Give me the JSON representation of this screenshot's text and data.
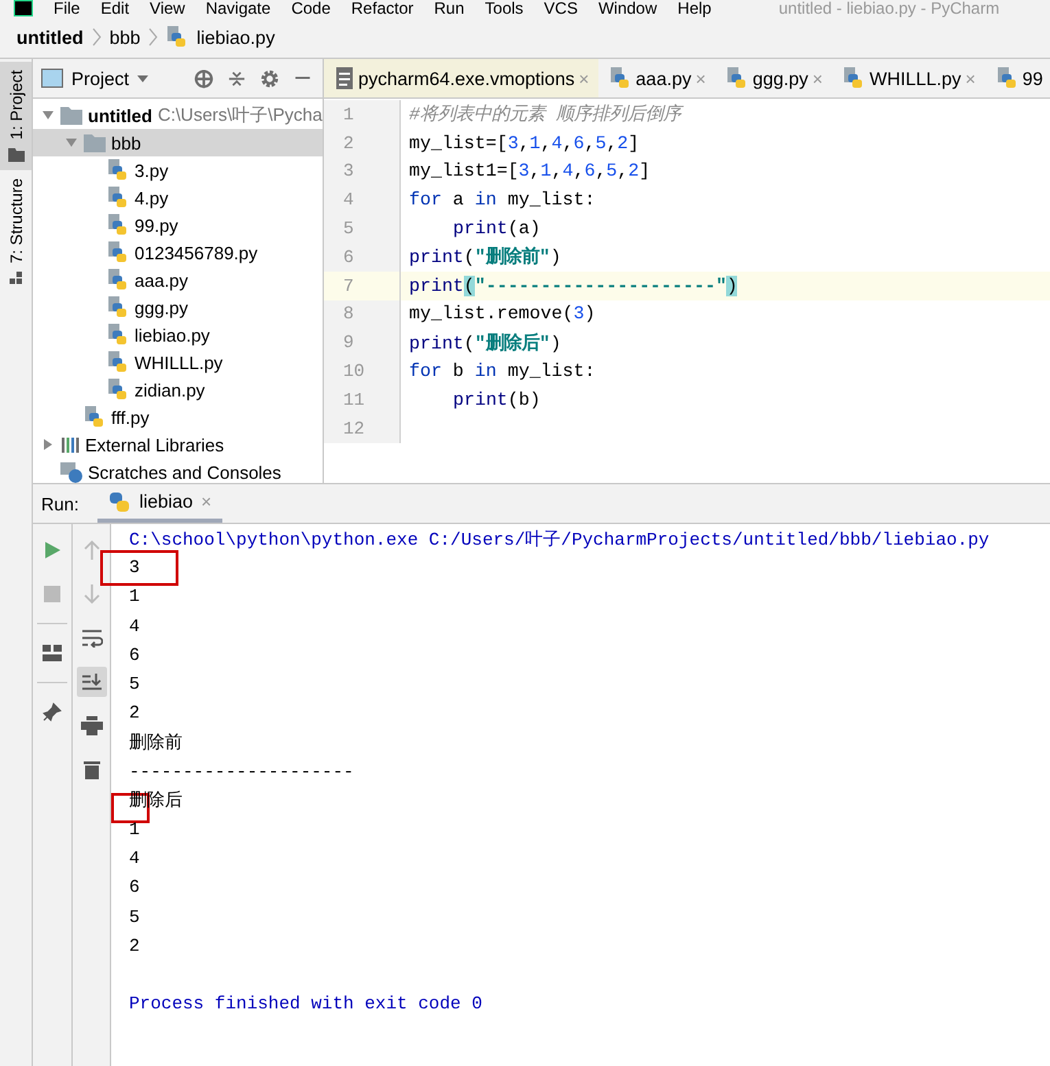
{
  "window": {
    "title": "untitled - liebiao.py - PyCharm"
  },
  "menu": [
    "File",
    "Edit",
    "View",
    "Navigate",
    "Code",
    "Refactor",
    "Run",
    "Tools",
    "VCS",
    "Window",
    "Help"
  ],
  "breadcrumbs": [
    "untitled",
    "bbb",
    "liebiao.py"
  ],
  "tool_strip": [
    {
      "label": "1: Project",
      "kind": "project",
      "selected": true
    },
    {
      "label": "7: Structure",
      "kind": "structure",
      "selected": false
    }
  ],
  "project_panel": {
    "title": "Project",
    "tree": [
      {
        "name": "untitled",
        "path": "C:\\Users\\叶子\\Pycha",
        "kind": "folder",
        "expanded": true,
        "selected": false,
        "children": [
          {
            "name": "bbb",
            "kind": "folder",
            "expanded": true,
            "selected": true,
            "children": [
              {
                "name": "3.py",
                "kind": "python",
                "selected": false
              },
              {
                "name": "4.py",
                "kind": "python",
                "selected": false
              },
              {
                "name": "99.py",
                "kind": "python",
                "selected": false
              },
              {
                "name": "0123456789.py",
                "kind": "python",
                "selected": false
              },
              {
                "name": "aaa.py",
                "kind": "python",
                "selected": false
              },
              {
                "name": "ggg.py",
                "kind": "python",
                "selected": false
              },
              {
                "name": "liebiao.py",
                "kind": "python",
                "selected": false
              },
              {
                "name": "WHILLL.py",
                "kind": "python",
                "selected": false
              },
              {
                "name": "zidian.py",
                "kind": "python",
                "selected": false
              }
            ]
          },
          {
            "name": "fff.py",
            "kind": "python",
            "selected": false
          }
        ]
      },
      {
        "name": "External Libraries",
        "kind": "libraries",
        "expanded": false,
        "selected": false
      },
      {
        "name": "Scratches and Consoles",
        "kind": "scratches",
        "selected": false
      }
    ]
  },
  "editor": {
    "tabs": [
      {
        "label": "pycharm64.exe.vmoptions",
        "kind": "text",
        "selected": true,
        "close": "×"
      },
      {
        "label": "aaa.py",
        "kind": "python",
        "selected": false,
        "close": "×"
      },
      {
        "label": "ggg.py",
        "kind": "python",
        "selected": false,
        "close": "×"
      },
      {
        "label": "WHILLL.py",
        "kind": "python",
        "selected": false,
        "close": "×"
      },
      {
        "label": "99",
        "kind": "python",
        "selected": false
      }
    ],
    "lines": [
      {
        "number": "1",
        "current": false,
        "tokens": [
          {
            "text": "#将列表中的元素 顺序排列后倒序",
            "kind": "comment"
          }
        ]
      },
      {
        "number": "2",
        "current": false,
        "tokens": [
          {
            "text": "my_list=[",
            "kind": "name"
          },
          {
            "text": "3",
            "kind": "number"
          },
          {
            "text": ",",
            "kind": "name"
          },
          {
            "text": "1",
            "kind": "number"
          },
          {
            "text": ",",
            "kind": "name"
          },
          {
            "text": "4",
            "kind": "number"
          },
          {
            "text": ",",
            "kind": "name"
          },
          {
            "text": "6",
            "kind": "number"
          },
          {
            "text": ",",
            "kind": "name"
          },
          {
            "text": "5",
            "kind": "number"
          },
          {
            "text": ",",
            "kind": "name"
          },
          {
            "text": "2",
            "kind": "number"
          },
          {
            "text": "]",
            "kind": "name"
          }
        ]
      },
      {
        "number": "3",
        "current": false,
        "tokens": [
          {
            "text": "my_list1=[",
            "kind": "name"
          },
          {
            "text": "3",
            "kind": "number"
          },
          {
            "text": ",",
            "kind": "name"
          },
          {
            "text": "1",
            "kind": "number"
          },
          {
            "text": ",",
            "kind": "name"
          },
          {
            "text": "4",
            "kind": "number"
          },
          {
            "text": ",",
            "kind": "name"
          },
          {
            "text": "6",
            "kind": "number"
          },
          {
            "text": ",",
            "kind": "name"
          },
          {
            "text": "5",
            "kind": "number"
          },
          {
            "text": ",",
            "kind": "name"
          },
          {
            "text": "2",
            "kind": "number"
          },
          {
            "text": "]",
            "kind": "name"
          }
        ]
      },
      {
        "number": "4",
        "current": false,
        "tokens": [
          {
            "text": "for",
            "kind": "keyword"
          },
          {
            "text": " a ",
            "kind": "name"
          },
          {
            "text": "in",
            "kind": "keyword"
          },
          {
            "text": " my_list:",
            "kind": "name"
          }
        ]
      },
      {
        "number": "5",
        "current": false,
        "indented": true,
        "tokens": [
          {
            "text": "print",
            "kind": "builtin"
          },
          {
            "text": "(a)",
            "kind": "name"
          }
        ]
      },
      {
        "number": "6",
        "current": false,
        "tokens": [
          {
            "text": "print",
            "kind": "builtin"
          },
          {
            "text": "(",
            "kind": "name"
          },
          {
            "text": "\"删除前\"",
            "kind": "string"
          },
          {
            "text": ")",
            "kind": "name"
          }
        ]
      },
      {
        "number": "7",
        "current": true,
        "tokens": [
          {
            "text": "print",
            "kind": "builtin"
          },
          {
            "text": "(",
            "kind": "brace"
          },
          {
            "text": "\"---------------------\"",
            "kind": "string"
          },
          {
            "text": ")",
            "kind": "brace"
          }
        ]
      },
      {
        "number": "8",
        "current": false,
        "tokens": [
          {
            "text": "my_list.remove(",
            "kind": "name"
          },
          {
            "text": "3",
            "kind": "number"
          },
          {
            "text": ")",
            "kind": "name"
          }
        ]
      },
      {
        "number": "9",
        "current": false,
        "tokens": [
          {
            "text": "print",
            "kind": "builtin"
          },
          {
            "text": "(",
            "kind": "name"
          },
          {
            "text": "\"删除后\"",
            "kind": "string"
          },
          {
            "text": ")",
            "kind": "name"
          }
        ]
      },
      {
        "number": "10",
        "current": false,
        "tokens": [
          {
            "text": "for",
            "kind": "keyword"
          },
          {
            "text": " b ",
            "kind": "name"
          },
          {
            "text": "in",
            "kind": "keyword"
          },
          {
            "text": " my_list:",
            "kind": "name"
          }
        ]
      },
      {
        "number": "11",
        "current": false,
        "indented": true,
        "tokens": [
          {
            "text": "print",
            "kind": "builtin"
          },
          {
            "text": "(b)",
            "kind": "name"
          }
        ]
      },
      {
        "number": "12",
        "current": false
      }
    ]
  },
  "run_panel": {
    "label": "Run:",
    "tabs": [
      {
        "label": "liebiao",
        "selected": true,
        "close": "×"
      }
    ],
    "console": [
      {
        "text": "C:\\school\\python\\python.exe C:/Users/叶子/PycharmProjects/untitled/bbb/liebiao.py",
        "kind": "command",
        "highlighted": false
      },
      {
        "text": "3",
        "kind": "output",
        "highlighted": true
      },
      {
        "text": "1",
        "kind": "output",
        "highlighted": false
      },
      {
        "text": "4",
        "kind": "output",
        "highlighted": false
      },
      {
        "text": "6",
        "kind": "output",
        "highlighted": false
      },
      {
        "text": "5",
        "kind": "output",
        "highlighted": false
      },
      {
        "text": "2",
        "kind": "output",
        "highlighted": false
      },
      {
        "text": "删除前",
        "kind": "output",
        "highlighted": false
      },
      {
        "text": "---------------------",
        "kind": "output",
        "highlighted": false
      },
      {
        "text": "删除后",
        "kind": "output",
        "highlighted": true
      },
      {
        "text": "1",
        "kind": "output",
        "highlighted": false
      },
      {
        "text": "4",
        "kind": "output",
        "highlighted": false
      },
      {
        "text": "6",
        "kind": "output",
        "highlighted": false
      },
      {
        "text": "5",
        "kind": "output",
        "highlighted": false
      },
      {
        "text": "2",
        "kind": "output",
        "highlighted": false
      },
      {
        "text": "Process finished with exit code 0",
        "kind": "status",
        "highlighted": false
      }
    ]
  }
}
